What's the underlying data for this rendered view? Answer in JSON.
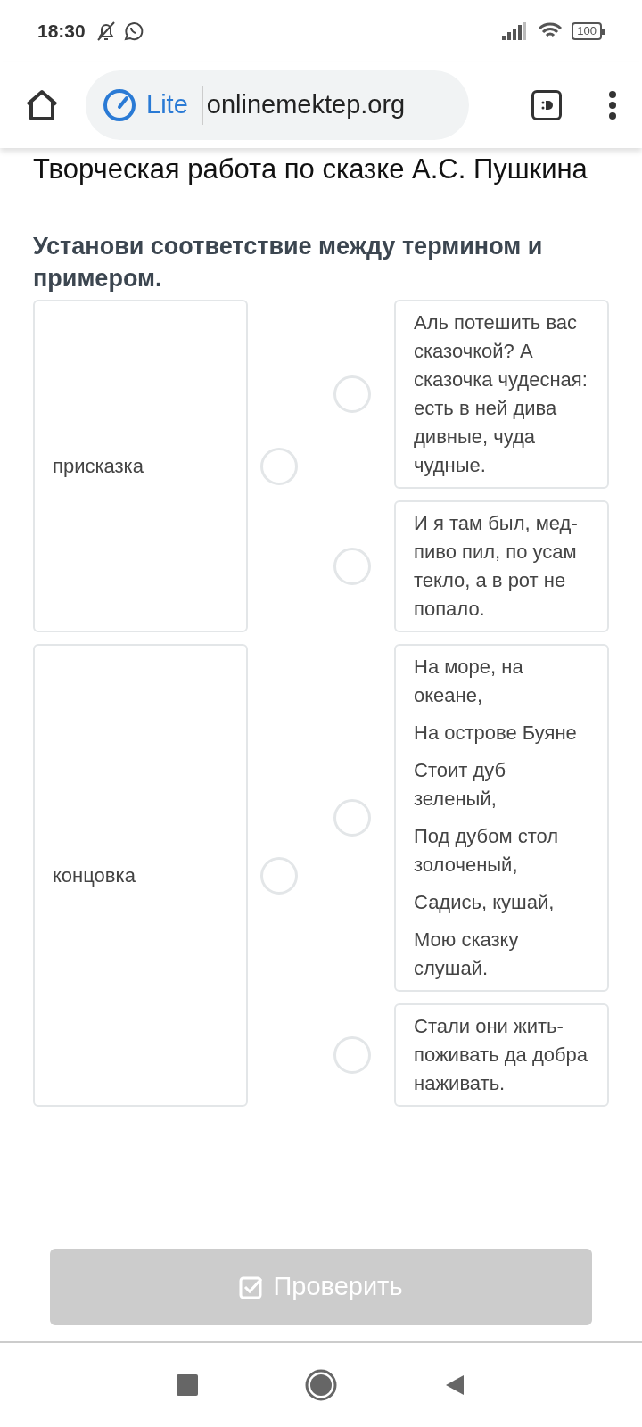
{
  "status_bar": {
    "time": "18:30",
    "battery": "100"
  },
  "browser": {
    "lite_label": "Lite",
    "url": "onlinemektep.org"
  },
  "page": {
    "title": "Творческая работа по сказке А.С. Пушкина",
    "question": "Установи соответствие между термином и примером.",
    "groups": [
      {
        "term": {
          "text": "присказка",
          "selected": false
        },
        "examples": [
          {
            "lines": [
              "Аль потешить вас сказочкой? А сказочка чудесная: есть в ней дива дивные, чуда чудные."
            ],
            "selected": false
          },
          {
            "lines": [
              "И я там был, мед-пиво пил, по усам текло, а в рот не попало."
            ],
            "selected": false
          }
        ]
      },
      {
        "term": {
          "text": "концовка",
          "selected": false
        },
        "examples": [
          {
            "lines": [
              "На море, на океане,",
              "На острове Буяне",
              "Стоит дуб зеленый,",
              "Под дубом стол золоченый,",
              "Садись, кушай,",
              "Мою сказку слушай."
            ],
            "selected": false
          },
          {
            "lines": [
              "Стали они жить-поживать да добра наживать."
            ],
            "selected": false
          }
        ]
      }
    ],
    "check_button": {
      "label": "Проверить",
      "disabled": true
    }
  }
}
